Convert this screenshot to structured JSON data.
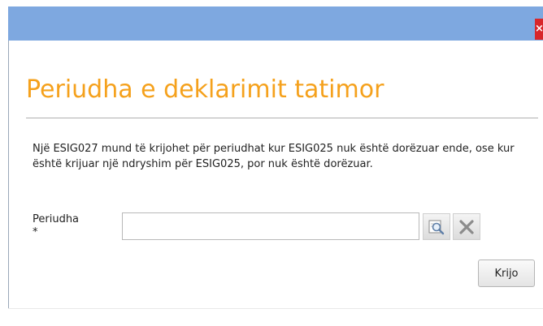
{
  "window": {
    "close_glyph": "×"
  },
  "dialog": {
    "title": "Periudha e deklarimit tatimor",
    "description": "Një ESIG027 mund të krijohet për periudhat kur ESIG025 nuk është dorëzuar ende, ose kur është krijuar një ndryshim për ESIG025, por nuk është dorëzuar.",
    "field": {
      "label": "Periudha",
      "required_marker": "*",
      "value": ""
    },
    "icons": {
      "search": "search-icon",
      "clear": "clear-icon"
    },
    "create_button_label": "Krijo"
  },
  "colors": {
    "titlebar": "#7ea8e0",
    "title_text": "#f5a11c",
    "close": "#d8262a"
  }
}
